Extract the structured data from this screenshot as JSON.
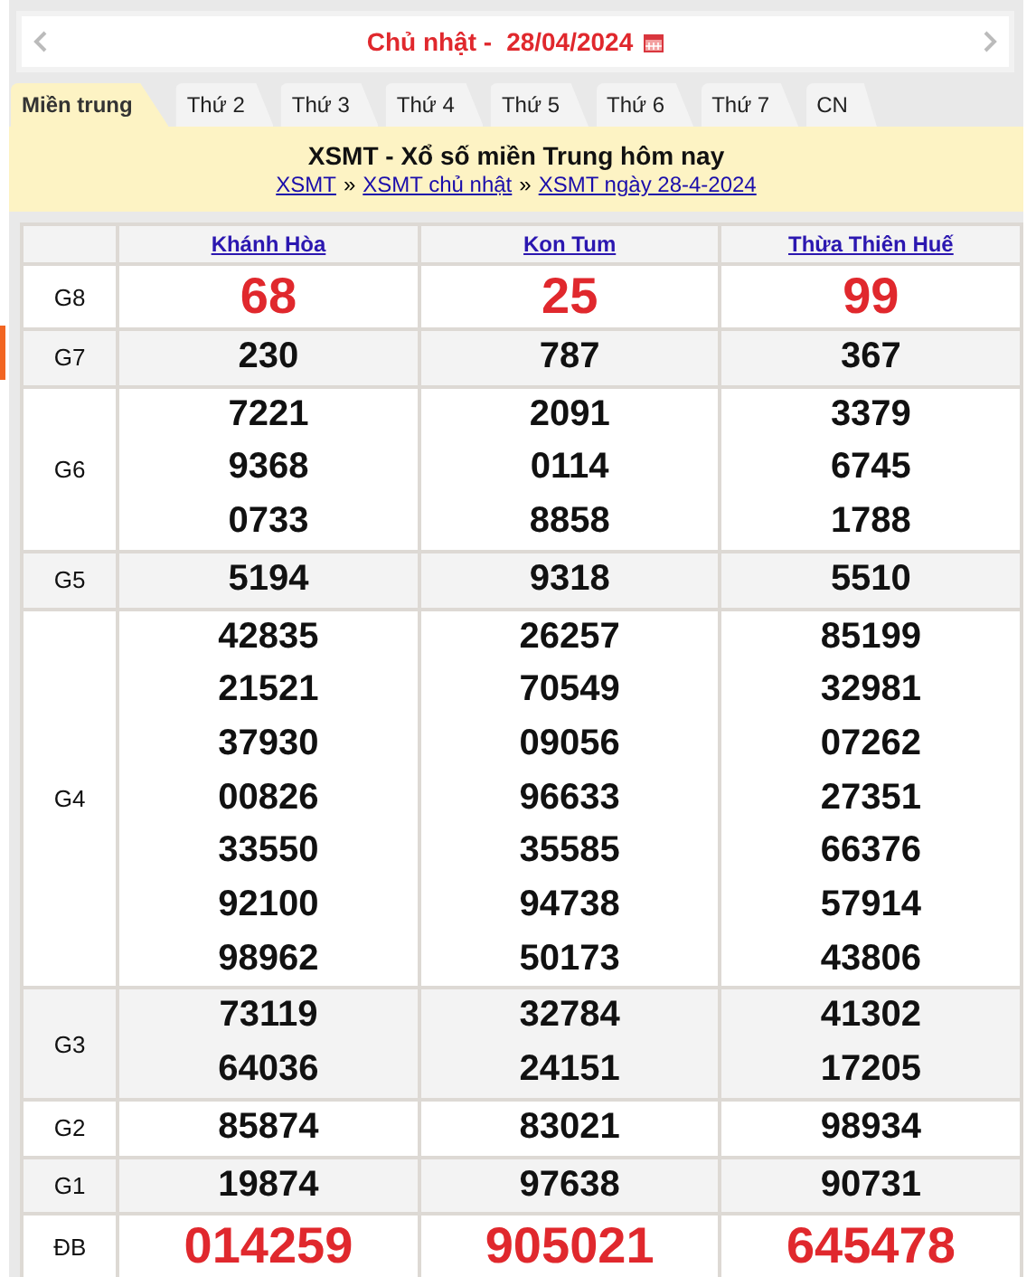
{
  "date_bar": {
    "day": "Chủ nhật -",
    "date": "28/04/2024"
  },
  "tabs": [
    {
      "label": "Miền trung",
      "selected": true
    },
    {
      "label": "Thứ 2",
      "selected": false
    },
    {
      "label": "Thứ 3",
      "selected": false
    },
    {
      "label": "Thứ 4",
      "selected": false
    },
    {
      "label": "Thứ 5",
      "selected": false
    },
    {
      "label": "Thứ 6",
      "selected": false
    },
    {
      "label": "Thứ 7",
      "selected": false
    },
    {
      "label": "CN",
      "selected": false
    }
  ],
  "header": {
    "title": "XSMT - Xổ số miền Trung hôm nay",
    "breadcrumbs": [
      "XSMT",
      "XSMT chủ nhật",
      "XSMT ngày 28-4-2024"
    ],
    "separator": "»"
  },
  "table": {
    "provinces": [
      "Khánh Hòa",
      "Kon Tum",
      "Thừa Thiên Huế"
    ],
    "rows": [
      {
        "prize": "G8",
        "highlight": true,
        "values": [
          [
            "68"
          ],
          [
            "25"
          ],
          [
            "99"
          ]
        ]
      },
      {
        "prize": "G7",
        "highlight": false,
        "values": [
          [
            "230"
          ],
          [
            "787"
          ],
          [
            "367"
          ]
        ]
      },
      {
        "prize": "G6",
        "highlight": false,
        "values": [
          [
            "7221",
            "9368",
            "0733"
          ],
          [
            "2091",
            "0114",
            "8858"
          ],
          [
            "3379",
            "6745",
            "1788"
          ]
        ]
      },
      {
        "prize": "G5",
        "highlight": false,
        "values": [
          [
            "5194"
          ],
          [
            "9318"
          ],
          [
            "5510"
          ]
        ]
      },
      {
        "prize": "G4",
        "highlight": false,
        "values": [
          [
            "42835",
            "21521",
            "37930",
            "00826",
            "33550",
            "92100",
            "98962"
          ],
          [
            "26257",
            "70549",
            "09056",
            "96633",
            "35585",
            "94738",
            "50173"
          ],
          [
            "85199",
            "32981",
            "07262",
            "27351",
            "66376",
            "57914",
            "43806"
          ]
        ]
      },
      {
        "prize": "G3",
        "highlight": false,
        "values": [
          [
            "73119",
            "64036"
          ],
          [
            "32784",
            "24151"
          ],
          [
            "41302",
            "17205"
          ]
        ]
      },
      {
        "prize": "G2",
        "highlight": false,
        "values": [
          [
            "85874"
          ],
          [
            "83021"
          ],
          [
            "98934"
          ]
        ]
      },
      {
        "prize": "G1",
        "highlight": false,
        "values": [
          [
            "19874"
          ],
          [
            "97638"
          ],
          [
            "90731"
          ]
        ]
      },
      {
        "prize": "ĐB",
        "highlight": true,
        "values": [
          [
            "014259"
          ],
          [
            "905021"
          ],
          [
            "645478"
          ]
        ]
      }
    ]
  }
}
